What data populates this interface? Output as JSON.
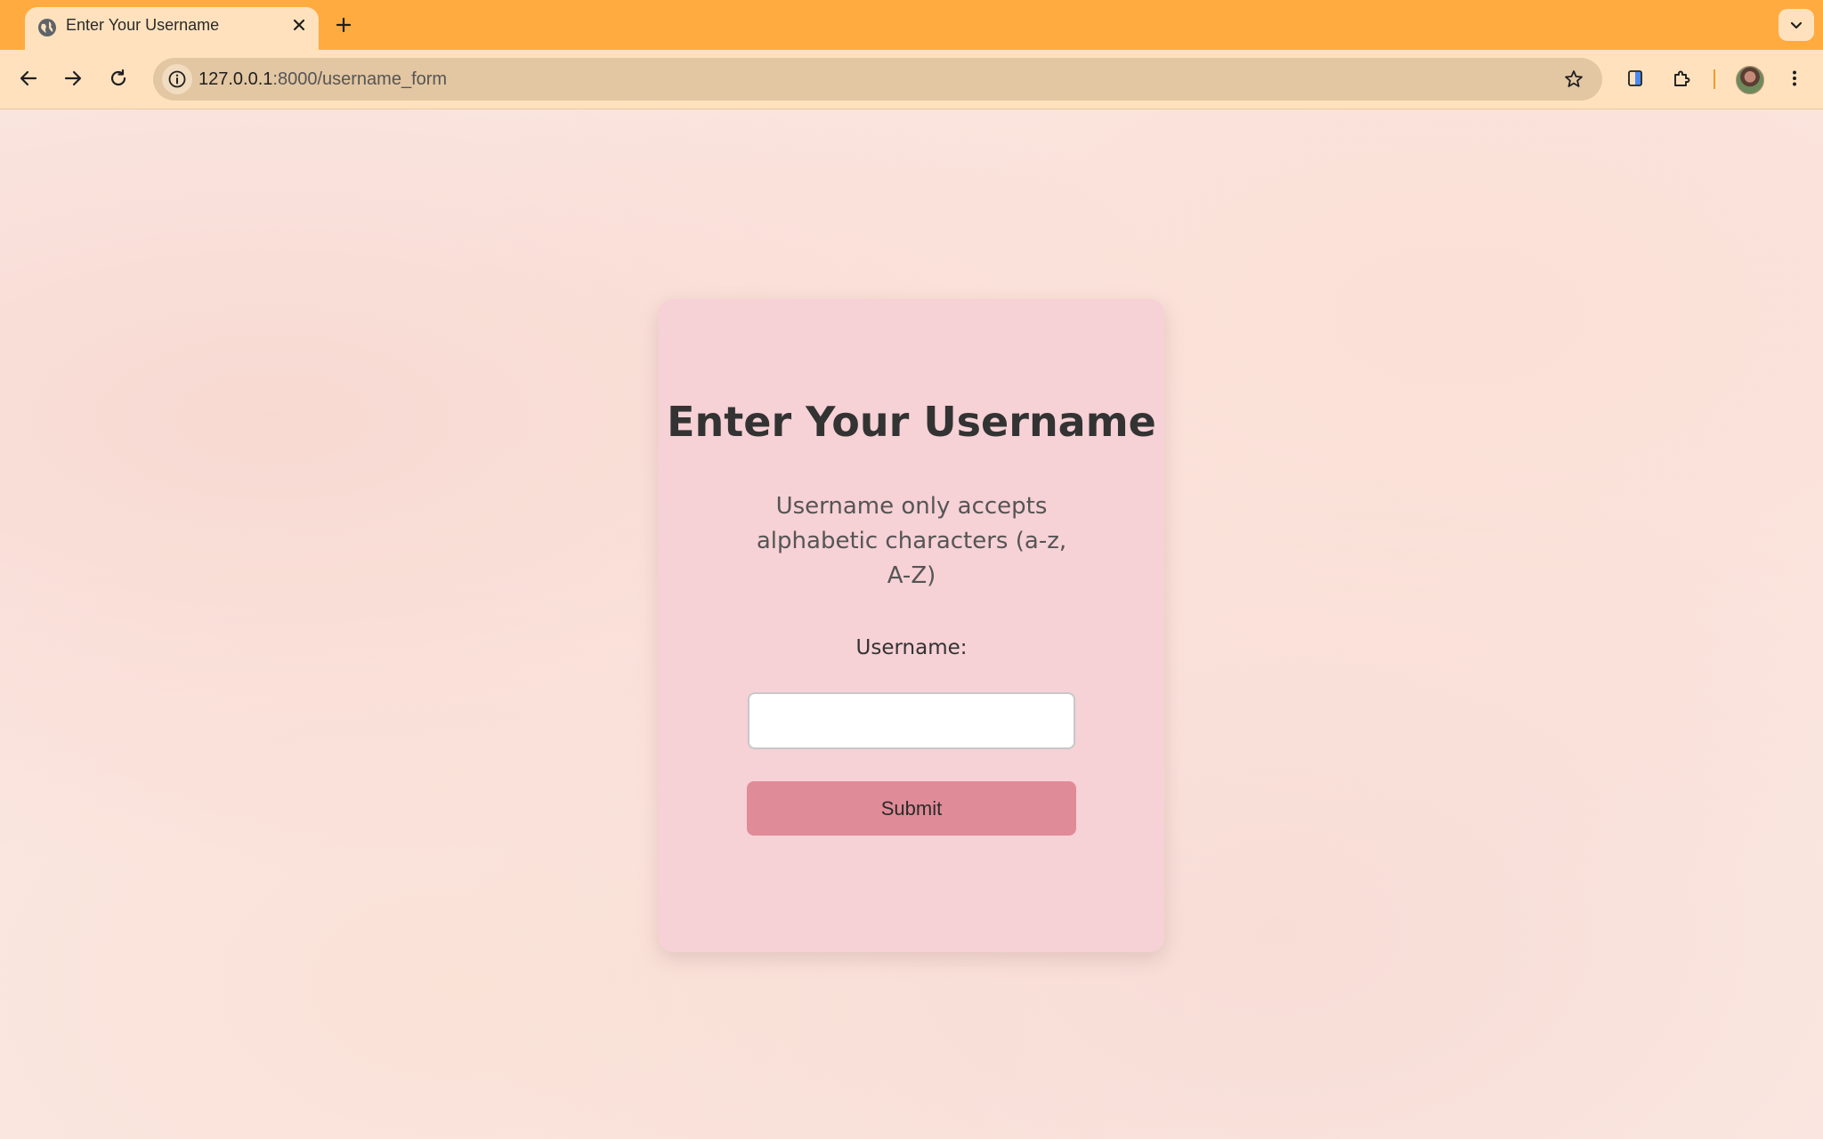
{
  "browser": {
    "tab": {
      "title": "Enter Your Username",
      "favicon": "globe-icon",
      "close_icon": "close-icon"
    },
    "new_tab_icon": "plus-icon",
    "tab_menu_icon": "chevron-down-icon",
    "toolbar": {
      "back_icon": "arrow-left-icon",
      "forward_icon": "arrow-right-icon",
      "reload_icon": "reload-icon",
      "site_info_icon": "info-icon",
      "url_host": "127.0.0.1",
      "url_rest": ":8000/username_form",
      "bookmark_icon": "star-icon",
      "extensions": [
        "sidebar-extension-icon",
        "puzzle-icon"
      ],
      "menu_icon": "more-vert-icon"
    },
    "colors": {
      "tabbar": "#ffab40",
      "toolbar": "#ffe2bd",
      "omnibox": "#e3c6a2"
    }
  },
  "form": {
    "title": "Enter Your Username",
    "hint": "Username only accepts alphabetic characters (a-z, A-Z)",
    "label": "Username:",
    "input_value": "",
    "submit_label": "Submit",
    "colors": {
      "card": "#f6d1d6",
      "button": "#e08b98"
    }
  }
}
